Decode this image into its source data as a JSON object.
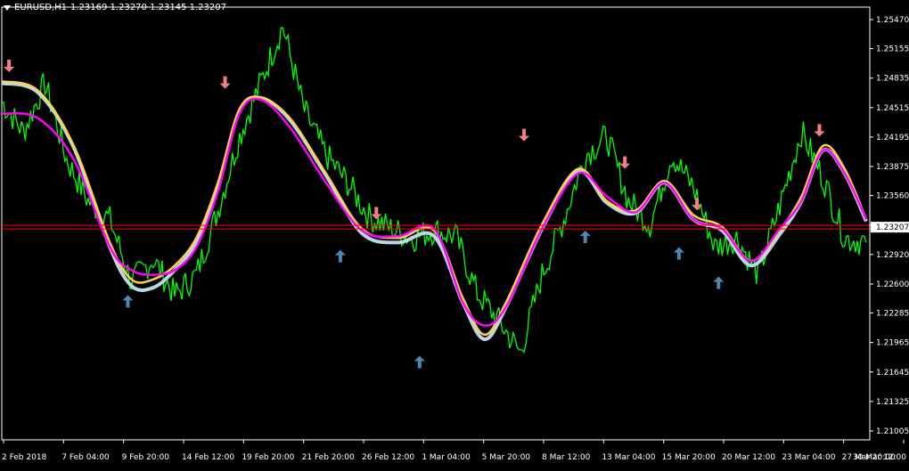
{
  "header": {
    "symbol_timeframe": "EURUSD,H1",
    "ohlc": "1.23169 1.23270 1.23145 1.23207"
  },
  "colors": {
    "background": "#000000",
    "price": "#00ff00",
    "fast_ma": "#ff00ff",
    "slow_ma": "#ffd24a",
    "lag_ma": "#b8d8e8",
    "arrow_down": "#f08080",
    "arrow_up": "#4f86b0",
    "price_line": "#ff0000",
    "axis": "#ffffff"
  },
  "chart_data": {
    "type": "line",
    "y_ticks": [
      "1.25470",
      "1.25155",
      "1.24835",
      "1.24515",
      "1.24195",
      "1.23875",
      "1.23560",
      "1.23240",
      "1.22920",
      "1.22600",
      "1.22285",
      "1.21965",
      "1.21645",
      "1.21325",
      "1.21005"
    ],
    "ylim": [
      1.21005,
      1.2547
    ],
    "x_ticks": [
      "2 Feb 2018",
      "7 Feb 04:00",
      "9 Feb 20:00",
      "14 Feb 12:00",
      "19 Feb 20:00",
      "21 Feb 20:00",
      "26 Feb 12:00",
      "1 Mar 04:00",
      "5 Mar 20:00",
      "8 Mar 12:00",
      "13 Mar 04:00",
      "15 Mar 20:00",
      "20 Mar 12:00",
      "23 Mar 04:00",
      "27 Mar 20:00",
      "30 Mar 12:00"
    ],
    "current_price": "1.23207",
    "series": [
      {
        "x": [
          0,
          6,
          12,
          18,
          24,
          30,
          36,
          42,
          48,
          54,
          60,
          66,
          72,
          78,
          84,
          90,
          96,
          102,
          108,
          114,
          120,
          126,
          132,
          138,
          144,
          150,
          156,
          162,
          168,
          174,
          180,
          186,
          192,
          198,
          204,
          210,
          216,
          222,
          228,
          234,
          240
        ],
        "values": [
          1.2458,
          1.2425,
          1.2478,
          1.2395,
          1.235,
          1.233,
          1.2262,
          1.2287,
          1.2248,
          1.227,
          1.234,
          1.242,
          1.248,
          1.254,
          1.2448,
          1.24,
          1.237,
          1.2333,
          1.232,
          1.231,
          1.2318,
          1.2312,
          1.225,
          1.222,
          1.2185,
          1.227,
          1.233,
          1.24,
          1.242,
          1.235,
          1.2325,
          1.24,
          1.2365,
          1.23,
          1.231,
          1.227,
          1.2345,
          1.2425,
          1.2375,
          1.231,
          1.2305
        ]
      },
      {
        "x": [
          0,
          10,
          20,
          30,
          36,
          42,
          48,
          54,
          60,
          66,
          72,
          80,
          90,
          100,
          110,
          120,
          128,
          134,
          140,
          150,
          160,
          168,
          176,
          184,
          192,
          200,
          208,
          216,
          222,
          228,
          234,
          240
        ],
        "values": [
          1.2445,
          1.244,
          1.2395,
          1.23,
          1.2275,
          1.227,
          1.2275,
          1.23,
          1.236,
          1.2445,
          1.246,
          1.243,
          1.237,
          1.2318,
          1.2312,
          1.232,
          1.224,
          1.2215,
          1.2235,
          1.232,
          1.238,
          1.2355,
          1.2338,
          1.237,
          1.233,
          1.232,
          1.2285,
          1.232,
          1.235,
          1.2405,
          1.238,
          1.233
        ]
      },
      {
        "x": [
          0,
          10,
          20,
          30,
          36,
          42,
          48,
          54,
          60,
          66,
          72,
          80,
          90,
          100,
          110,
          120,
          128,
          134,
          140,
          150,
          160,
          168,
          176,
          184,
          192,
          200,
          208,
          216,
          222,
          228,
          234,
          240
        ],
        "values": [
          1.248,
          1.247,
          1.241,
          1.2305,
          1.2265,
          1.2265,
          1.228,
          1.231,
          1.237,
          1.245,
          1.2462,
          1.244,
          1.238,
          1.232,
          1.231,
          1.2318,
          1.2245,
          1.2205,
          1.224,
          1.2325,
          1.2385,
          1.235,
          1.234,
          1.2372,
          1.2335,
          1.2322,
          1.2285,
          1.2318,
          1.2355,
          1.241,
          1.2385,
          1.233
        ]
      },
      {
        "x": [
          0,
          10,
          20,
          30,
          36,
          42,
          48,
          54,
          60,
          66,
          72,
          80,
          90,
          100,
          110,
          120,
          128,
          134,
          140,
          150,
          160,
          168,
          176,
          184,
          192,
          200,
          208,
          216,
          222,
          228,
          234,
          240
        ],
        "values": [
          1.2478,
          1.2468,
          1.2408,
          1.23,
          1.2258,
          1.2256,
          1.2275,
          1.2305,
          1.2365,
          1.2448,
          1.2462,
          1.2438,
          1.2378,
          1.2315,
          1.2305,
          1.2312,
          1.224,
          1.22,
          1.2235,
          1.232,
          1.2382,
          1.2348,
          1.2337,
          1.237,
          1.233,
          1.2318,
          1.228,
          1.2314,
          1.235,
          1.2405,
          1.238,
          1.2328
        ]
      }
    ],
    "arrows_down": [
      {
        "x": 2,
        "value": 1.249
      },
      {
        "x": 62,
        "value": 1.2472
      },
      {
        "x": 104,
        "value": 1.233
      },
      {
        "x": 145,
        "value": 1.2415
      },
      {
        "x": 173,
        "value": 1.2385
      },
      {
        "x": 193,
        "value": 1.234
      },
      {
        "x": 227,
        "value": 1.242
      }
    ],
    "arrows_up": [
      {
        "x": 35,
        "value": 1.2248
      },
      {
        "x": 94,
        "value": 1.2297
      },
      {
        "x": 116,
        "value": 1.2182
      },
      {
        "x": 162,
        "value": 1.2318
      },
      {
        "x": 188,
        "value": 1.23
      },
      {
        "x": 199,
        "value": 1.2268
      }
    ]
  }
}
